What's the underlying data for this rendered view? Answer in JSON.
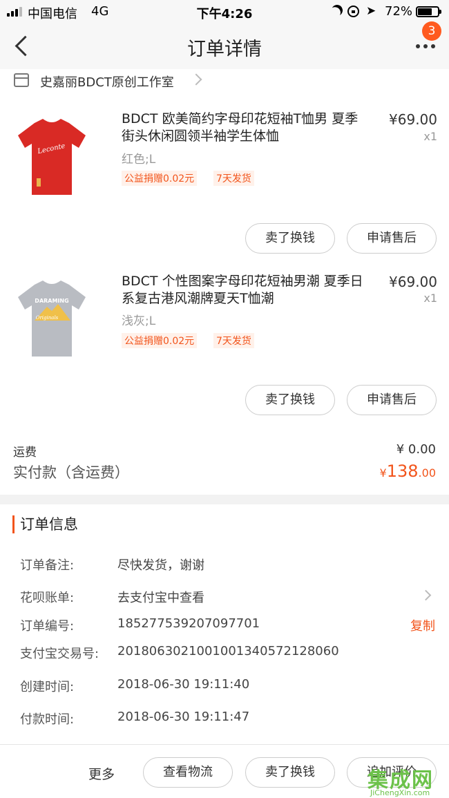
{
  "status_bar": {
    "carrier": "中国电信",
    "network": "4G",
    "time": "下午4:26",
    "battery_percent": "72%",
    "battery_level": 0.72,
    "icons": [
      "signal-icon",
      "moon-icon",
      "orientation-lock-icon",
      "location-arrow-icon",
      "battery-icon"
    ]
  },
  "nav": {
    "title": "订单详情",
    "badge_count": "3"
  },
  "shop": {
    "name": "史嘉丽BDCT原创工作室"
  },
  "products": [
    {
      "title": "BDCT 欧美简约字母印花短袖T恤男 夏季街头休闲圆领半袖学生体恤",
      "price": "¥69.00",
      "qty": "x1",
      "sku": "红色;L",
      "tags": [
        "公益捐赠0.02元",
        "7天发货"
      ],
      "buttons": [
        "卖了换钱",
        "申请售后"
      ],
      "image": "red-tshirt-image",
      "shirt_color": "#d92a25",
      "print_text": "Leconte"
    },
    {
      "title": "BDCT 个性图案字母印花短袖男潮 夏季日系复古港风潮牌夏天T恤潮",
      "price": "¥69.00",
      "qty": "x1",
      "sku": "浅灰;L",
      "tags": [
        "公益捐赠0.02元",
        "7天发货"
      ],
      "buttons": [
        "卖了换钱",
        "申请售后"
      ],
      "image": "gray-tshirt-image",
      "shirt_color": "#b9bcc2",
      "print_text": "DARAMING",
      "print_subtext": "Originals"
    }
  ],
  "totals": {
    "shipping_label": "运费",
    "shipping_value": "¥ 0.00",
    "paid_label": "实付款（含运费）",
    "paid_currency": "¥",
    "paid_int": "138",
    "paid_dec": ".00",
    "accent_color": "#f2541b"
  },
  "order_info": {
    "heading": "订单信息",
    "rows": [
      {
        "label": "订单备注:",
        "value": "尽快发货，谢谢"
      },
      {
        "label": "花呗账单:",
        "value": "去支付宝中查看"
      },
      {
        "label": "订单编号:",
        "value": "185277539207097701"
      },
      {
        "label": "支付宝交易号:",
        "value": "2018063021001001340572128060"
      },
      {
        "label": "创建时间:",
        "value": "2018-06-30 19:11:40"
      },
      {
        "label": "付款时间:",
        "value": "2018-06-30 19:11:47"
      }
    ],
    "copy_label": "复制"
  },
  "bottom_bar": {
    "more": "更多",
    "buttons": [
      "查看物流",
      "卖了换钱",
      "追加评价"
    ]
  },
  "watermark": {
    "text": "集成网",
    "url_text": "JiChengXin.com"
  }
}
